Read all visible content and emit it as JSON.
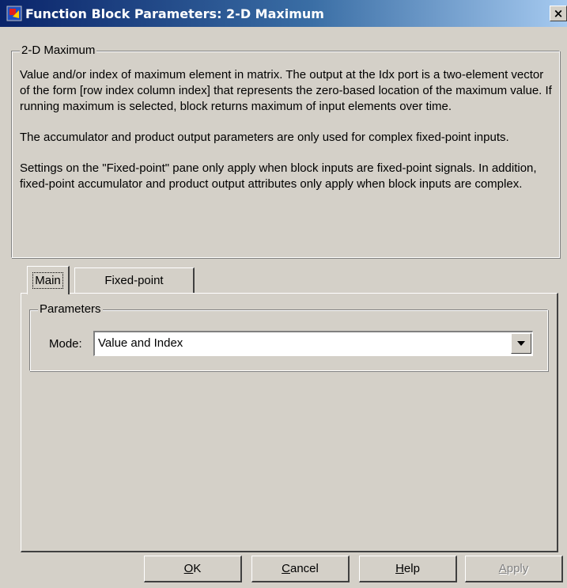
{
  "window": {
    "title": "Function Block Parameters: 2-D Maximum",
    "close_label": "×"
  },
  "description": {
    "group_label": "2-D Maximum",
    "paragraphs": [
      "Value and/or index of maximum element in matrix. The output at the Idx port is a two-element vector of the form [row index column index] that represents the zero-based location of the maximum value. If running maximum is selected, block returns maximum of input elements over time.",
      "The accumulator and product output parameters are only used for complex fixed-point inputs.",
      "Settings on the \"Fixed-point\" pane only apply when block inputs are fixed-point signals. In addition, fixed-point accumulator and product output attributes only apply when block inputs are complex."
    ]
  },
  "tabs": [
    {
      "label": "Main",
      "selected": true
    },
    {
      "label": "Fixed-point",
      "selected": false
    }
  ],
  "parameters": {
    "group_label": "Parameters",
    "mode_label": "Mode:",
    "mode_value": "Value and Index"
  },
  "buttons": {
    "ok": {
      "mnemonic": "O",
      "rest": "K"
    },
    "cancel": {
      "mnemonic": "C",
      "rest": "ancel"
    },
    "help": {
      "mnemonic": "H",
      "rest": "elp"
    },
    "apply": {
      "mnemonic": "A",
      "rest": "pply",
      "enabled": false
    }
  },
  "colors": {
    "title_bar_start": "#0a246a",
    "title_bar_end": "#a6caf0",
    "dialog_face": "#d4d0c8"
  },
  "icons": {
    "app": "simulink-block-icon",
    "dropdown": "chevron-down-icon",
    "close": "close-icon"
  }
}
